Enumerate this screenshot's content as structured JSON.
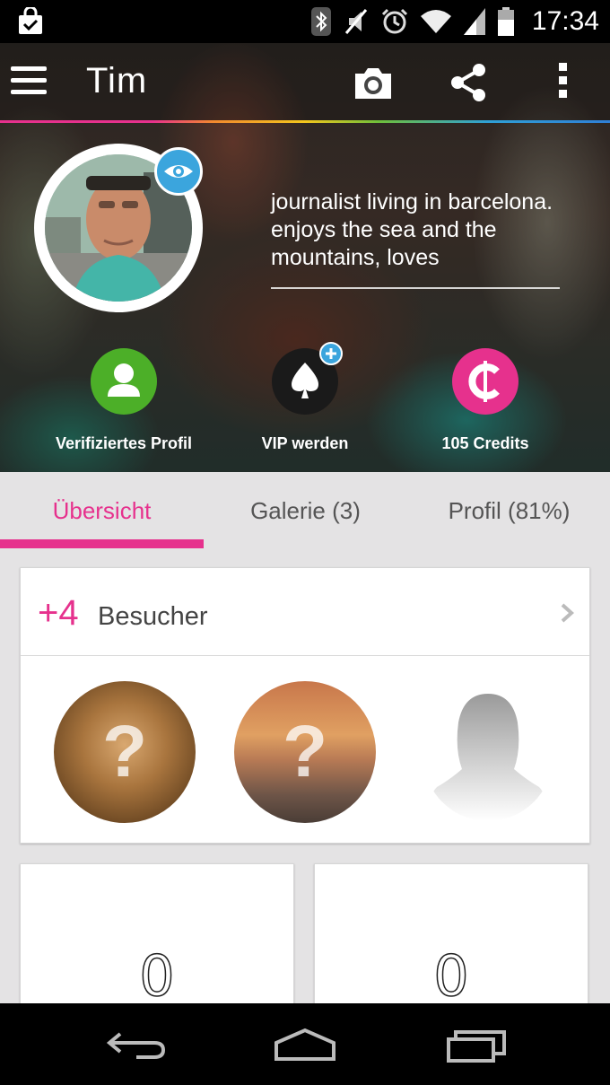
{
  "status_bar": {
    "time": "17:34",
    "icons": [
      "shopping-bag-icon",
      "bluetooth-icon",
      "mute-icon",
      "alarm-icon",
      "wifi-icon",
      "signal-icon",
      "battery-icon"
    ]
  },
  "header": {
    "title": "Tim",
    "icons": [
      "menu-icon",
      "camera-icon",
      "share-icon",
      "more-icon"
    ],
    "rainbow_colors": [
      "#e6318d",
      "#f28a2e",
      "#f3c61d",
      "#6fbf3a",
      "#2fa0d6"
    ]
  },
  "profile": {
    "bio": "journalist living in barcelona. enjoys the sea and the mountains, loves",
    "avatar_badge_icon": "eye-icon"
  },
  "actions": [
    {
      "label": "Verifiziertes Profil",
      "icon": "verified-user-icon",
      "color": "#4caf28"
    },
    {
      "label": "VIP werden",
      "icon": "vip-spade-icon",
      "color": "#1a1a1a"
    },
    {
      "label": "105 Credits",
      "icon": "credits-icon",
      "color": "#e6318d"
    }
  ],
  "tabs": [
    {
      "label": "Übersicht",
      "active": true
    },
    {
      "label": "Galerie (3)",
      "active": false
    },
    {
      "label": "Profil (81%)",
      "active": false
    }
  ],
  "visitors": {
    "count": "+4",
    "label": "Besucher",
    "avatars": [
      "blurred-visitor-photo",
      "blurred-visitor-photo",
      "silhouette-placeholder"
    ],
    "hidden_mark": "?"
  },
  "cards": [
    {
      "value": "0"
    },
    {
      "value": "0"
    }
  ],
  "colors": {
    "accent": "#e6318d",
    "badge_blue": "#3ba5dd"
  },
  "nav_bar": [
    "back-icon",
    "home-icon",
    "recent-apps-icon"
  ]
}
